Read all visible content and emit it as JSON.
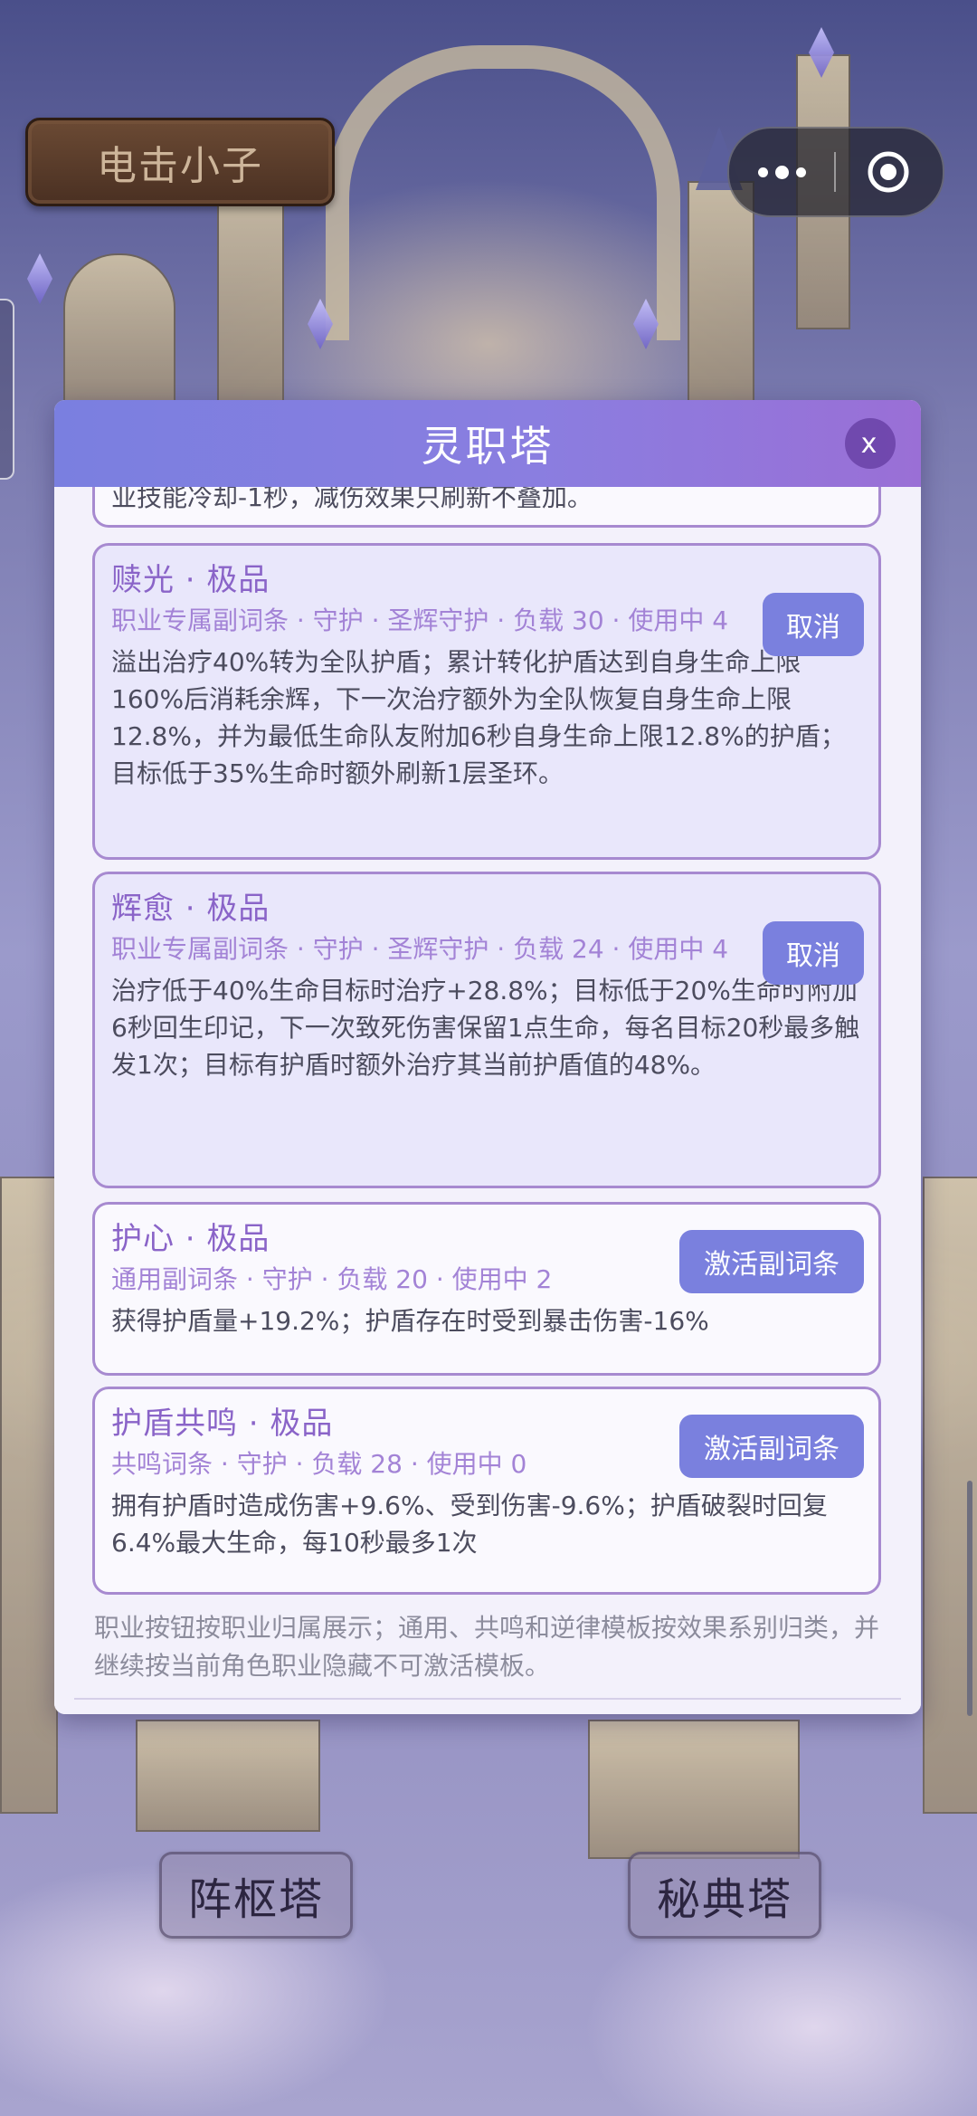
{
  "player": {
    "name": "电击小子"
  },
  "modal": {
    "title": "灵职塔",
    "close_label": "x",
    "partial_top_text": "业技能冷却-1秒，减伤效果只刷新不叠加。",
    "cards": [
      {
        "title": "赎光 · 极品",
        "meta": "职业专属副词条 · 守护 · 圣辉守护 · 负载 30 · 使用中 4",
        "description": "溢出治疗40%转为全队护盾；累计转化护盾达到自身生命上限160%后消耗余辉，下一次治疗额外为全队恢复自身生命上限12.8%，并为最低生命队友附加6秒自身生命上限12.8%的护盾；目标低于35%生命时额外刷新1层圣环。",
        "action": "取消",
        "state": "active"
      },
      {
        "title": "辉愈 · 极品",
        "meta": "职业专属副词条 · 守护 · 圣辉守护 · 负载 24 · 使用中 4",
        "description": "治疗低于40%生命目标时治疗+28.8%；目标低于20%生命时附加6秒回生印记，下一次致死伤害保留1点生命，每名目标20秒最多触发1次；目标有护盾时额外治疗其当前护盾值的48%。",
        "action": "取消",
        "state": "active"
      },
      {
        "title": "护心 · 极品",
        "meta": "通用副词条 · 守护 · 负载 20 · 使用中 2",
        "description": "获得护盾量+19.2%；护盾存在时受到暴击伤害-16%",
        "action": "激活副词条",
        "state": "inactive"
      },
      {
        "title": "护盾共鸣 · 极品",
        "meta": "共鸣词条 · 守护 · 负载 28 · 使用中 0",
        "description": "拥有护盾时造成伤害+9.6%、受到伤害-9.6%；护盾破裂时回复6.4%最大生命，每10秒最多1次",
        "action": "激活副词条",
        "state": "inactive"
      }
    ],
    "footer_note": "职业按钮按职业归属展示；通用、共鸣和逆律模板按效果系别归类，并继续按当前角色职业隐藏不可激活模板。"
  },
  "bottom_nav": {
    "left_tower": "阵枢塔",
    "right_tower": "秘典塔"
  },
  "colors": {
    "header_gradient_start": "#7a7fe0",
    "header_gradient_end": "#9a6fd6",
    "button_bg": "#7a80de",
    "card_title": "#8a64c8",
    "card_border": "#a78ad0"
  }
}
